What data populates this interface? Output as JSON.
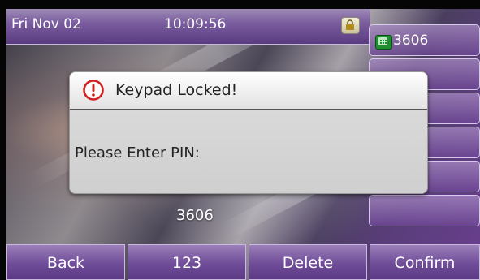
{
  "status_bar": {
    "date": "Fri Nov 02",
    "time": "10:09:56",
    "lock_icon": "padlock-icon"
  },
  "line_keys": [
    {
      "label": "3606",
      "icon": "phone-line-icon",
      "icon_color": "#1e8e2f"
    },
    {
      "label": ""
    },
    {
      "label": ""
    },
    {
      "label": ""
    },
    {
      "label": ""
    },
    {
      "label": ""
    }
  ],
  "dialog": {
    "title": "Keypad Locked!",
    "icon": "warning-circle-icon",
    "prompt": "Please Enter PIN:"
  },
  "pin_entry": {
    "value": "3606"
  },
  "softkeys": {
    "back": "Back",
    "input_mode": "123",
    "delete": "Delete",
    "confirm": "Confirm"
  },
  "colors": {
    "accent_purple": "#6f4c98",
    "warning_red": "#d21f1f"
  }
}
